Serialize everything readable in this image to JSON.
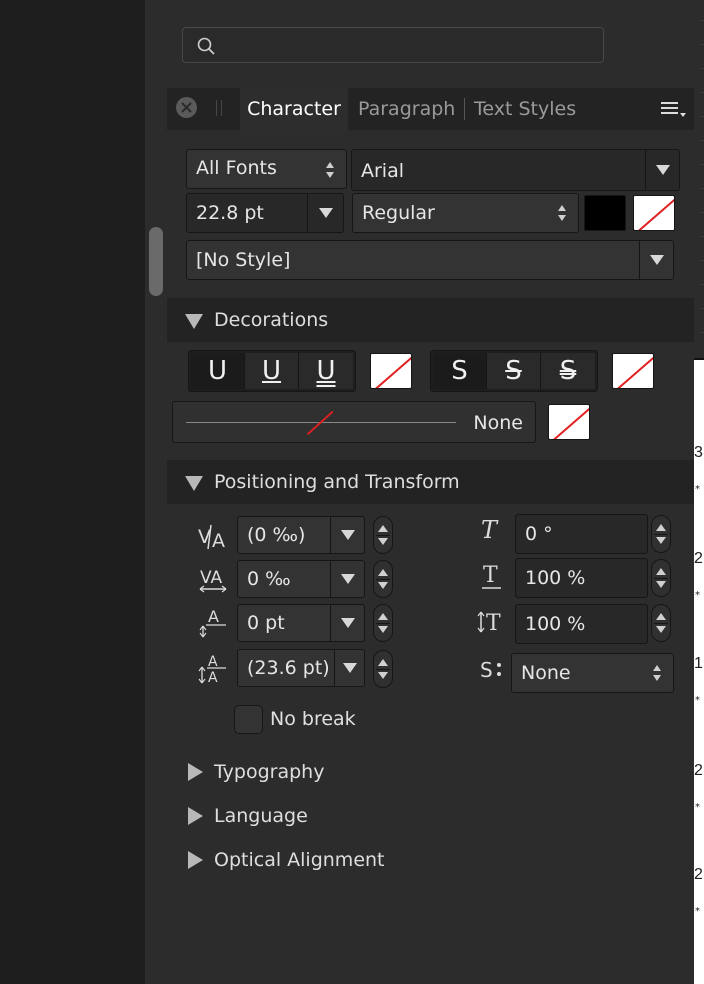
{
  "search": {
    "placeholder": ""
  },
  "tabs": [
    {
      "label": "Character",
      "active": true
    },
    {
      "label": "Paragraph",
      "active": false
    },
    {
      "label": "Text Styles",
      "active": false
    }
  ],
  "character": {
    "font_collection": "All Fonts",
    "font_family": "Arial",
    "font_size": "22.8 pt",
    "font_style": "Regular",
    "text_fill_color": "#000000",
    "style": "[No Style]"
  },
  "decorations": {
    "title": "Decorations",
    "underline_buttons": [
      "U",
      "U",
      "U"
    ],
    "strike_buttons": [
      "S",
      "S",
      "S"
    ],
    "line_style": "None"
  },
  "positioning": {
    "title": "Positioning and Transform",
    "tracking": "(0 ‰)",
    "kerning": "0 ‰",
    "baseline_shift": "0 pt",
    "leading": "(23.6 pt)",
    "shear": "0 °",
    "vertical_scale": "100 %",
    "horizontal_scale": "100 %",
    "typographic_case": "None",
    "no_break_label": "No break"
  },
  "collapsed_sections": [
    "Typography",
    "Language",
    "Optical Alignment"
  ],
  "right_doc": {
    "numbers": [
      "3",
      "2",
      "1",
      "2",
      "2"
    ]
  },
  "colors": {
    "panel_bg": "#2c2c2c",
    "header_bg": "#232323",
    "no_fill_line": "#e02020"
  }
}
